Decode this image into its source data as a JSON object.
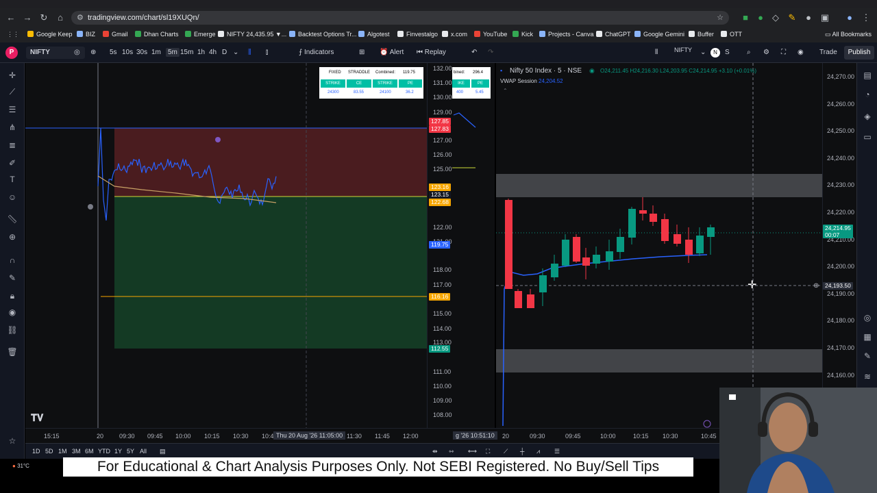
{
  "browser": {
    "url": "tradingview.com/chart/sl19XUQn/",
    "bookmarks": [
      {
        "label": "Google Keep",
        "color": "#fbbc04"
      },
      {
        "label": "BIZ",
        "color": "#8ab4f8"
      },
      {
        "label": "Gmail",
        "color": "#ea4335"
      },
      {
        "label": "Dhan Charts",
        "color": "#34a853"
      },
      {
        "label": "Emerge",
        "color": "#34a853"
      },
      {
        "label": "NIFTY 24,435.95 ▼...",
        "color": "#e8eaed"
      },
      {
        "label": "Backtest Options Tr...",
        "color": "#8ab4f8"
      },
      {
        "label": "Algotest",
        "color": "#8ab4f8"
      },
      {
        "label": "Finvestalgo",
        "color": "#e8eaed"
      },
      {
        "label": "x.com",
        "color": "#e8eaed"
      },
      {
        "label": "YouTube",
        "color": "#ea4335"
      },
      {
        "label": "Kick",
        "color": "#34a853"
      },
      {
        "label": "Projects - Canva",
        "color": "#8ab4f8"
      },
      {
        "label": "ChatGPT",
        "color": "#e8eaed"
      },
      {
        "label": "Google Gemini",
        "color": "#8ab4f8"
      },
      {
        "label": "Buffer",
        "color": "#e8eaed"
      },
      {
        "label": "OTT",
        "color": "#e8eaed"
      }
    ],
    "all_bookmarks": "All Bookmarks"
  },
  "toolbar": {
    "avatar": "P",
    "symbol": "NIFTY",
    "intervals": [
      "5s",
      "10s",
      "30s",
      "1m",
      "5m",
      "15m",
      "1h",
      "4h",
      "D"
    ],
    "active_interval": "5m",
    "indicators": "Indicators",
    "alert": "Alert",
    "replay": "Replay",
    "symbol_right": "NIFTY",
    "trade": "Trade",
    "publish": "Publish"
  },
  "pane1": {
    "price_labels": [
      "132.00",
      "131.00",
      "130.00",
      "129.00",
      "127.00",
      "126.00",
      "125.00",
      "122.00",
      "121.00",
      "118.00",
      "117.00",
      "115.00",
      "114.00",
      "113.00",
      "111.00",
      "110.00",
      "109.00",
      "108.00"
    ],
    "tags": [
      {
        "text": "127.85",
        "color": "#f23645"
      },
      {
        "text": "127.83",
        "color": "#f23645"
      },
      {
        "text": "123.16",
        "color": "#f7a600"
      },
      {
        "text": "123.15",
        "color": "#131722"
      },
      {
        "text": "122.68",
        "color": "#f7a600"
      },
      {
        "text": "119.75",
        "color": "#2962ff"
      },
      {
        "text": "116.16",
        "color": "#f7a600"
      },
      {
        "text": "112.55",
        "color": "#089981"
      }
    ],
    "table": {
      "header": [
        "FIXED",
        "STRADDLE",
        "Combined:",
        "119.75"
      ],
      "row1": [
        "STRIKE",
        "CE",
        "STRIKE",
        "PE"
      ],
      "row2": [
        "24300",
        "83.55",
        "24100",
        "36.2"
      ]
    },
    "table2": {
      "header": [
        "bined:",
        "296.4"
      ],
      "row1": [
        "IKE",
        "PE"
      ],
      "row2": [
        "400",
        "5.45"
      ]
    }
  },
  "pane3": {
    "title": "Nifty 50 Index · 5 · NSE",
    "ohlc": "O24,211.45 H24,216.30 L24,203.95 C24,214.95 +3.10 (+0.01%)",
    "vwap_label": "VWAP Session",
    "vwap_value": "24,204.52",
    "price_labels": [
      "24,270.00",
      "24,260.00",
      "24,250.00",
      "24,240.00",
      "24,230.00",
      "24,220.00",
      "24,210.00",
      "24,200.00",
      "24,190.00",
      "24,180.00",
      "24,170.00",
      "24,160.00"
    ],
    "last_price": "24,214.95",
    "countdown": "00:07",
    "cursor_price": "24,193.50"
  },
  "time_axis": {
    "pane1": [
      "15:15",
      "20",
      "09:30",
      "09:45",
      "10:00",
      "10:15",
      "10:30",
      "10:4"
    ],
    "pane1_cursor": "Thu 20 Aug '26  11:05:00",
    "pane1_after": [
      "11:30",
      "11:45",
      "12:00"
    ],
    "pane2_cursor": "g '26  10:51:10",
    "pane3": [
      "20",
      "09:30",
      "09:45",
      "10:00",
      "10:15",
      "10:30",
      "10:45"
    ]
  },
  "ranges": [
    "1D",
    "5D",
    "1M",
    "3M",
    "6M",
    "YTD",
    "1Y",
    "5Y",
    "All"
  ],
  "taskbar": {
    "weather": "31°C"
  },
  "banner": "For Educational & Chart Analysis Purposes Only. Not SEBI Registered. No Buy/Sell Tips",
  "colors": {
    "bull": "#089981",
    "bear": "#f23645",
    "vwap": "#2962ff",
    "accent": "#f7a600"
  }
}
